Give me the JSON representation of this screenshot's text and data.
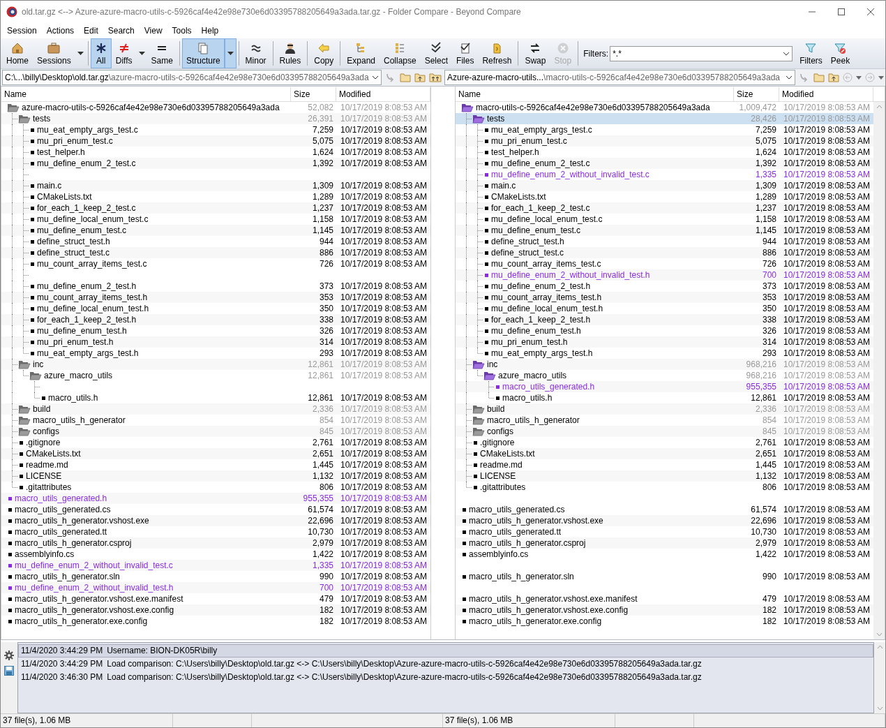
{
  "window": {
    "title": "old.tar.gz <--> Azure-azure-macro-utils-c-5926caf4e42e98e730e6d03395788205649a3ada.tar.gz - Folder Compare - Beyond Compare"
  },
  "menu": [
    "Session",
    "Actions",
    "Edit",
    "Search",
    "View",
    "Tools",
    "Help"
  ],
  "toolbar": {
    "groups": [
      [
        {
          "label": "Home",
          "selected": false,
          "disabled": false,
          "dropdown": false
        },
        {
          "label": "Sessions",
          "selected": false,
          "disabled": false,
          "dropdown": true
        }
      ],
      [
        {
          "label": "All",
          "selected": true,
          "disabled": false,
          "dropdown": false
        },
        {
          "label": "Diffs",
          "selected": false,
          "disabled": false,
          "dropdown": true
        },
        {
          "label": "Same",
          "selected": false,
          "disabled": false,
          "dropdown": false
        }
      ],
      [
        {
          "label": "Structure",
          "selected": true,
          "disabled": false,
          "dropdown": true
        }
      ],
      [
        {
          "label": "Minor",
          "selected": false,
          "disabled": false,
          "dropdown": false
        }
      ],
      [
        {
          "label": "Rules",
          "selected": false,
          "disabled": false,
          "dropdown": false
        }
      ],
      [
        {
          "label": "Copy",
          "selected": false,
          "disabled": false,
          "dropdown": false
        }
      ],
      [
        {
          "label": "Expand",
          "selected": false,
          "disabled": false,
          "dropdown": false
        },
        {
          "label": "Collapse",
          "selected": false,
          "disabled": false,
          "dropdown": false
        },
        {
          "label": "Select",
          "selected": false,
          "disabled": false,
          "dropdown": false
        },
        {
          "label": "Files",
          "selected": false,
          "disabled": false,
          "dropdown": false
        },
        {
          "label": "Refresh",
          "selected": false,
          "disabled": false,
          "dropdown": false
        }
      ],
      [
        {
          "label": "Swap",
          "selected": false,
          "disabled": false,
          "dropdown": false
        },
        {
          "label": "Stop",
          "selected": false,
          "disabled": true,
          "dropdown": false
        }
      ]
    ],
    "filters": {
      "label": "Filters:",
      "value": "*.*"
    },
    "end_buttons": [
      {
        "label": "Filters",
        "selected": false,
        "disabled": false,
        "dropdown": false
      },
      {
        "label": "Peek",
        "selected": false,
        "disabled": false,
        "dropdown": false
      }
    ]
  },
  "panes": [
    {
      "path": {
        "base": "C:\\...\\billy\\Desktop\\old.tar.gz",
        "sub": "\\azure-macro-utils-c-5926caf4e42e98e730e6d03395788205649a3ada"
      },
      "columns": [
        "Name",
        "Size",
        "Modified"
      ],
      "rows": [
        {
          "kind": "folder",
          "name": "azure-macro-utils-c-5926caf4e42e98e730e6d03395788205649a3ada",
          "size": "52,082",
          "modified": "10/17/2019 8:08:53 AM",
          "contains_orphans": false,
          "selected": false,
          "children": [
            {
              "kind": "folder",
              "name": "tests",
              "size": "26,391",
              "modified": "10/17/2019 8:08:53 AM",
              "contains_orphans": false,
              "selected": false,
              "children": [
                {
                  "kind": "file",
                  "name": "mu_eat_empty_args_test.c",
                  "size": "7,259",
                  "modified": "10/17/2019 8:08:53 AM",
                  "orphan": false,
                  "selected": false
                },
                {
                  "kind": "file",
                  "name": "mu_pri_enum_test.c",
                  "size": "5,075",
                  "modified": "10/17/2019 8:08:53 AM",
                  "orphan": false,
                  "selected": false
                },
                {
                  "kind": "file",
                  "name": "test_helper.h",
                  "size": "1,624",
                  "modified": "10/17/2019 8:08:53 AM",
                  "orphan": false,
                  "selected": false
                },
                {
                  "kind": "file",
                  "name": "mu_define_enum_2_test.c",
                  "size": "1,392",
                  "modified": "10/17/2019 8:08:53 AM",
                  "orphan": false,
                  "selected": false
                },
                {
                  "kind": "gap"
                },
                {
                  "kind": "file",
                  "name": "main.c",
                  "size": "1,309",
                  "modified": "10/17/2019 8:08:53 AM",
                  "orphan": false,
                  "selected": false
                },
                {
                  "kind": "file",
                  "name": "CMakeLists.txt",
                  "size": "1,289",
                  "modified": "10/17/2019 8:08:53 AM",
                  "orphan": false,
                  "selected": false
                },
                {
                  "kind": "file",
                  "name": "for_each_1_keep_2_test.c",
                  "size": "1,237",
                  "modified": "10/17/2019 8:08:53 AM",
                  "orphan": false,
                  "selected": false
                },
                {
                  "kind": "file",
                  "name": "mu_define_local_enum_test.c",
                  "size": "1,158",
                  "modified": "10/17/2019 8:08:53 AM",
                  "orphan": false,
                  "selected": false
                },
                {
                  "kind": "file",
                  "name": "mu_define_enum_test.c",
                  "size": "1,145",
                  "modified": "10/17/2019 8:08:53 AM",
                  "orphan": false,
                  "selected": false
                },
                {
                  "kind": "file",
                  "name": "define_struct_test.h",
                  "size": "944",
                  "modified": "10/17/2019 8:08:53 AM",
                  "orphan": false,
                  "selected": false
                },
                {
                  "kind": "file",
                  "name": "define_struct_test.c",
                  "size": "886",
                  "modified": "10/17/2019 8:08:53 AM",
                  "orphan": false,
                  "selected": false
                },
                {
                  "kind": "file",
                  "name": "mu_count_array_items_test.c",
                  "size": "726",
                  "modified": "10/17/2019 8:08:53 AM",
                  "orphan": false,
                  "selected": false
                },
                {
                  "kind": "gap"
                },
                {
                  "kind": "file",
                  "name": "mu_define_enum_2_test.h",
                  "size": "373",
                  "modified": "10/17/2019 8:08:53 AM",
                  "orphan": false,
                  "selected": false
                },
                {
                  "kind": "file",
                  "name": "mu_count_array_items_test.h",
                  "size": "353",
                  "modified": "10/17/2019 8:08:53 AM",
                  "orphan": false,
                  "selected": false
                },
                {
                  "kind": "file",
                  "name": "mu_define_local_enum_test.h",
                  "size": "350",
                  "modified": "10/17/2019 8:08:53 AM",
                  "orphan": false,
                  "selected": false
                },
                {
                  "kind": "file",
                  "name": "for_each_1_keep_2_test.h",
                  "size": "338",
                  "modified": "10/17/2019 8:08:53 AM",
                  "orphan": false,
                  "selected": false
                },
                {
                  "kind": "file",
                  "name": "mu_define_enum_test.h",
                  "size": "326",
                  "modified": "10/17/2019 8:08:53 AM",
                  "orphan": false,
                  "selected": false
                },
                {
                  "kind": "file",
                  "name": "mu_pri_enum_test.h",
                  "size": "314",
                  "modified": "10/17/2019 8:08:53 AM",
                  "orphan": false,
                  "selected": false
                },
                {
                  "kind": "file",
                  "name": "mu_eat_empty_args_test.h",
                  "size": "293",
                  "modified": "10/17/2019 8:08:53 AM",
                  "orphan": false,
                  "selected": false
                }
              ]
            },
            {
              "kind": "folder",
              "name": "inc",
              "size": "12,861",
              "modified": "10/17/2019 8:08:53 AM",
              "contains_orphans": false,
              "selected": false,
              "children": [
                {
                  "kind": "folder",
                  "name": "azure_macro_utils",
                  "size": "12,861",
                  "modified": "10/17/2019 8:08:53 AM",
                  "contains_orphans": false,
                  "selected": false,
                  "children": [
                    {
                      "kind": "gap"
                    },
                    {
                      "kind": "file",
                      "name": "macro_utils.h",
                      "size": "12,861",
                      "modified": "10/17/2019 8:08:53 AM",
                      "orphan": false,
                      "selected": false
                    }
                  ]
                }
              ]
            },
            {
              "kind": "folder",
              "name": "build",
              "size": "2,336",
              "modified": "10/17/2019 8:08:53 AM",
              "contains_orphans": false,
              "selected": false
            },
            {
              "kind": "folder",
              "name": "macro_utils_h_generator",
              "size": "854",
              "modified": "10/17/2019 8:08:53 AM",
              "contains_orphans": false,
              "selected": false
            },
            {
              "kind": "folder",
              "name": "configs",
              "size": "845",
              "modified": "10/17/2019 8:08:53 AM",
              "contains_orphans": false,
              "selected": false
            },
            {
              "kind": "file",
              "name": ".gitignore",
              "size": "2,761",
              "modified": "10/17/2019 8:08:53 AM",
              "orphan": false,
              "selected": false
            },
            {
              "kind": "file",
              "name": "CMakeLists.txt",
              "size": "2,651",
              "modified": "10/17/2019 8:08:53 AM",
              "orphan": false,
              "selected": false
            },
            {
              "kind": "file",
              "name": "readme.md",
              "size": "1,445",
              "modified": "10/17/2019 8:08:53 AM",
              "orphan": false,
              "selected": false
            },
            {
              "kind": "file",
              "name": "LICENSE",
              "size": "1,132",
              "modified": "10/17/2019 8:08:53 AM",
              "orphan": false,
              "selected": false
            },
            {
              "kind": "file",
              "name": ".gitattributes",
              "size": "806",
              "modified": "10/17/2019 8:08:53 AM",
              "orphan": false,
              "selected": false
            }
          ]
        },
        {
          "kind": "file",
          "name": "macro_utils_generated.h",
          "size": "955,355",
          "modified": "10/17/2019 8:08:53 AM",
          "orphan": true,
          "selected": false
        },
        {
          "kind": "file",
          "name": "macro_utils_generated.cs",
          "size": "61,574",
          "modified": "10/17/2019 8:08:53 AM",
          "orphan": false,
          "selected": false
        },
        {
          "kind": "file",
          "name": "macro_utils_h_generator.vshost.exe",
          "size": "22,696",
          "modified": "10/17/2019 8:08:53 AM",
          "orphan": false,
          "selected": false
        },
        {
          "kind": "file",
          "name": "macro_utils_generated.tt",
          "size": "10,730",
          "modified": "10/17/2019 8:08:53 AM",
          "orphan": false,
          "selected": false
        },
        {
          "kind": "file",
          "name": "macro_utils_h_generator.csproj",
          "size": "2,979",
          "modified": "10/17/2019 8:08:53 AM",
          "orphan": false,
          "selected": false
        },
        {
          "kind": "file",
          "name": "assemblyinfo.cs",
          "size": "1,422",
          "modified": "10/17/2019 8:08:53 AM",
          "orphan": false,
          "selected": false
        },
        {
          "kind": "file",
          "name": "mu_define_enum_2_without_invalid_test.c",
          "size": "1,335",
          "modified": "10/17/2019 8:08:53 AM",
          "orphan": true,
          "selected": false
        },
        {
          "kind": "file",
          "name": "macro_utils_h_generator.sln",
          "size": "990",
          "modified": "10/17/2019 8:08:53 AM",
          "orphan": false,
          "selected": false
        },
        {
          "kind": "file",
          "name": "mu_define_enum_2_without_invalid_test.h",
          "size": "700",
          "modified": "10/17/2019 8:08:53 AM",
          "orphan": true,
          "selected": false
        },
        {
          "kind": "file",
          "name": "macro_utils_h_generator.vshost.exe.manifest",
          "size": "479",
          "modified": "10/17/2019 8:08:53 AM",
          "orphan": false,
          "selected": false
        },
        {
          "kind": "file",
          "name": "macro_utils_h_generator.vshost.exe.config",
          "size": "182",
          "modified": "10/17/2019 8:08:53 AM",
          "orphan": false,
          "selected": false
        },
        {
          "kind": "file",
          "name": "macro_utils_h_generator.exe.config",
          "size": "182",
          "modified": "10/17/2019 8:08:53 AM",
          "orphan": false,
          "selected": false
        }
      ]
    },
    {
      "path": {
        "base": "Azure-azure-macro-utils...",
        "sub": "\\macro-utils-c-5926caf4e42e98e730e6d03395788205649a3ada"
      },
      "columns": [
        "Name",
        "Size",
        "Modified"
      ],
      "rows": [
        {
          "kind": "folder",
          "name": "macro-utils-c-5926caf4e42e98e730e6d03395788205649a3ada",
          "size": "1,009,472",
          "modified": "10/17/2019 8:08:53 AM",
          "contains_orphans": true,
          "selected": false,
          "children": [
            {
              "kind": "folder",
              "name": "tests",
              "size": "28,426",
              "modified": "10/17/2019 8:08:53 AM",
              "contains_orphans": true,
              "selected": true,
              "children": [
                {
                  "kind": "file",
                  "name": "mu_eat_empty_args_test.c",
                  "size": "7,259",
                  "modified": "10/17/2019 8:08:53 AM",
                  "orphan": false,
                  "selected": false
                },
                {
                  "kind": "file",
                  "name": "mu_pri_enum_test.c",
                  "size": "5,075",
                  "modified": "10/17/2019 8:08:53 AM",
                  "orphan": false,
                  "selected": false
                },
                {
                  "kind": "file",
                  "name": "test_helper.h",
                  "size": "1,624",
                  "modified": "10/17/2019 8:08:53 AM",
                  "orphan": false,
                  "selected": false
                },
                {
                  "kind": "file",
                  "name": "mu_define_enum_2_test.c",
                  "size": "1,392",
                  "modified": "10/17/2019 8:08:53 AM",
                  "orphan": false,
                  "selected": false
                },
                {
                  "kind": "file",
                  "name": "mu_define_enum_2_without_invalid_test.c",
                  "size": "1,335",
                  "modified": "10/17/2019 8:08:53 AM",
                  "orphan": true,
                  "selected": false
                },
                {
                  "kind": "file",
                  "name": "main.c",
                  "size": "1,309",
                  "modified": "10/17/2019 8:08:53 AM",
                  "orphan": false,
                  "selected": false
                },
                {
                  "kind": "file",
                  "name": "CMakeLists.txt",
                  "size": "1,289",
                  "modified": "10/17/2019 8:08:53 AM",
                  "orphan": false,
                  "selected": false
                },
                {
                  "kind": "file",
                  "name": "for_each_1_keep_2_test.c",
                  "size": "1,237",
                  "modified": "10/17/2019 8:08:53 AM",
                  "orphan": false,
                  "selected": false
                },
                {
                  "kind": "file",
                  "name": "mu_define_local_enum_test.c",
                  "size": "1,158",
                  "modified": "10/17/2019 8:08:53 AM",
                  "orphan": false,
                  "selected": false
                },
                {
                  "kind": "file",
                  "name": "mu_define_enum_test.c",
                  "size": "1,145",
                  "modified": "10/17/2019 8:08:53 AM",
                  "orphan": false,
                  "selected": false
                },
                {
                  "kind": "file",
                  "name": "define_struct_test.h",
                  "size": "944",
                  "modified": "10/17/2019 8:08:53 AM",
                  "orphan": false,
                  "selected": false
                },
                {
                  "kind": "file",
                  "name": "define_struct_test.c",
                  "size": "886",
                  "modified": "10/17/2019 8:08:53 AM",
                  "orphan": false,
                  "selected": false
                },
                {
                  "kind": "file",
                  "name": "mu_count_array_items_test.c",
                  "size": "726",
                  "modified": "10/17/2019 8:08:53 AM",
                  "orphan": false,
                  "selected": false
                },
                {
                  "kind": "file",
                  "name": "mu_define_enum_2_without_invalid_test.h",
                  "size": "700",
                  "modified": "10/17/2019 8:08:53 AM",
                  "orphan": true,
                  "selected": false
                },
                {
                  "kind": "file",
                  "name": "mu_define_enum_2_test.h",
                  "size": "373",
                  "modified": "10/17/2019 8:08:53 AM",
                  "orphan": false,
                  "selected": false
                },
                {
                  "kind": "file",
                  "name": "mu_count_array_items_test.h",
                  "size": "353",
                  "modified": "10/17/2019 8:08:53 AM",
                  "orphan": false,
                  "selected": false
                },
                {
                  "kind": "file",
                  "name": "mu_define_local_enum_test.h",
                  "size": "350",
                  "modified": "10/17/2019 8:08:53 AM",
                  "orphan": false,
                  "selected": false
                },
                {
                  "kind": "file",
                  "name": "for_each_1_keep_2_test.h",
                  "size": "338",
                  "modified": "10/17/2019 8:08:53 AM",
                  "orphan": false,
                  "selected": false
                },
                {
                  "kind": "file",
                  "name": "mu_define_enum_test.h",
                  "size": "326",
                  "modified": "10/17/2019 8:08:53 AM",
                  "orphan": false,
                  "selected": false
                },
                {
                  "kind": "file",
                  "name": "mu_pri_enum_test.h",
                  "size": "314",
                  "modified": "10/17/2019 8:08:53 AM",
                  "orphan": false,
                  "selected": false
                },
                {
                  "kind": "file",
                  "name": "mu_eat_empty_args_test.h",
                  "size": "293",
                  "modified": "10/17/2019 8:08:53 AM",
                  "orphan": false,
                  "selected": false
                }
              ]
            },
            {
              "kind": "folder",
              "name": "inc",
              "size": "968,216",
              "modified": "10/17/2019 8:08:53 AM",
              "contains_orphans": true,
              "selected": false,
              "children": [
                {
                  "kind": "folder",
                  "name": "azure_macro_utils",
                  "size": "968,216",
                  "modified": "10/17/2019 8:08:53 AM",
                  "contains_orphans": true,
                  "selected": false,
                  "children": [
                    {
                      "kind": "file",
                      "name": "macro_utils_generated.h",
                      "size": "955,355",
                      "modified": "10/17/2019 8:08:53 AM",
                      "orphan": true,
                      "selected": false
                    },
                    {
                      "kind": "file",
                      "name": "macro_utils.h",
                      "size": "12,861",
                      "modified": "10/17/2019 8:08:53 AM",
                      "orphan": false,
                      "selected": false
                    }
                  ]
                }
              ]
            },
            {
              "kind": "folder",
              "name": "build",
              "size": "2,336",
              "modified": "10/17/2019 8:08:53 AM",
              "contains_orphans": false,
              "selected": false
            },
            {
              "kind": "folder",
              "name": "macro_utils_h_generator",
              "size": "854",
              "modified": "10/17/2019 8:08:53 AM",
              "contains_orphans": false,
              "selected": false
            },
            {
              "kind": "folder",
              "name": "configs",
              "size": "845",
              "modified": "10/17/2019 8:08:53 AM",
              "contains_orphans": false,
              "selected": false
            },
            {
              "kind": "file",
              "name": ".gitignore",
              "size": "2,761",
              "modified": "10/17/2019 8:08:53 AM",
              "orphan": false,
              "selected": false
            },
            {
              "kind": "file",
              "name": "CMakeLists.txt",
              "size": "2,651",
              "modified": "10/17/2019 8:08:53 AM",
              "orphan": false,
              "selected": false
            },
            {
              "kind": "file",
              "name": "readme.md",
              "size": "1,445",
              "modified": "10/17/2019 8:08:53 AM",
              "orphan": false,
              "selected": false
            },
            {
              "kind": "file",
              "name": "LICENSE",
              "size": "1,132",
              "modified": "10/17/2019 8:08:53 AM",
              "orphan": false,
              "selected": false
            },
            {
              "kind": "file",
              "name": ".gitattributes",
              "size": "806",
              "modified": "10/17/2019 8:08:53 AM",
              "orphan": false,
              "selected": false
            }
          ]
        },
        {
          "kind": "gap"
        },
        {
          "kind": "file",
          "name": "macro_utils_generated.cs",
          "size": "61,574",
          "modified": "10/17/2019 8:08:53 AM",
          "orphan": false,
          "selected": false
        },
        {
          "kind": "file",
          "name": "macro_utils_h_generator.vshost.exe",
          "size": "22,696",
          "modified": "10/17/2019 8:08:53 AM",
          "orphan": false,
          "selected": false
        },
        {
          "kind": "file",
          "name": "macro_utils_generated.tt",
          "size": "10,730",
          "modified": "10/17/2019 8:08:53 AM",
          "orphan": false,
          "selected": false
        },
        {
          "kind": "file",
          "name": "macro_utils_h_generator.csproj",
          "size": "2,979",
          "modified": "10/17/2019 8:08:53 AM",
          "orphan": false,
          "selected": false
        },
        {
          "kind": "file",
          "name": "assemblyinfo.cs",
          "size": "1,422",
          "modified": "10/17/2019 8:08:53 AM",
          "orphan": false,
          "selected": false
        },
        {
          "kind": "gap"
        },
        {
          "kind": "file",
          "name": "macro_utils_h_generator.sln",
          "size": "990",
          "modified": "10/17/2019 8:08:53 AM",
          "orphan": false,
          "selected": false
        },
        {
          "kind": "gap"
        },
        {
          "kind": "file",
          "name": "macro_utils_h_generator.vshost.exe.manifest",
          "size": "479",
          "modified": "10/17/2019 8:08:53 AM",
          "orphan": false,
          "selected": false
        },
        {
          "kind": "file",
          "name": "macro_utils_h_generator.vshost.exe.config",
          "size": "182",
          "modified": "10/17/2019 8:08:53 AM",
          "orphan": false,
          "selected": false
        },
        {
          "kind": "file",
          "name": "macro_utils_h_generator.exe.config",
          "size": "182",
          "modified": "10/17/2019 8:08:53 AM",
          "orphan": false,
          "selected": false
        }
      ]
    }
  ],
  "log": [
    {
      "time": "11/4/2020 3:44:29 PM",
      "message": "Username: BION-DK05R\\billy",
      "selected": true
    },
    {
      "time": "11/4/2020 3:44:29 PM",
      "message": "Load comparison: C:\\Users\\billy\\Desktop\\old.tar.gz <-> C:\\Users\\billy\\Desktop\\Azure-azure-macro-utils-c-5926caf4e42e98e730e6d03395788205649a3ada.tar.gz",
      "selected": false
    },
    {
      "time": "11/4/2020 3:46:30 PM",
      "message": "Load comparison: C:\\Users\\billy\\Desktop\\old.tar.gz <-> C:\\Users\\billy\\Desktop\\Azure-azure-macro-utils-c-5926caf4e42e98e730e6d03395788205649a3ada.tar.gz",
      "selected": false
    }
  ],
  "status_bar": [
    "37 file(s), 1.06 MB",
    "37 file(s), 1.06 MB"
  ]
}
